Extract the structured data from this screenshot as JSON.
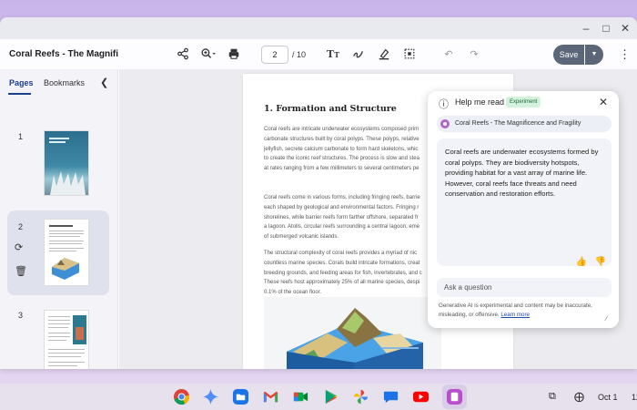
{
  "app": {
    "document_title": "Coral Reefs - The Magnific...",
    "page_current": "2",
    "page_total": "/ 10",
    "save_label": "Save"
  },
  "sidebar": {
    "tabs": [
      "Pages",
      "Bookmarks"
    ],
    "thumbnails": [
      {
        "number": "1"
      },
      {
        "number": "2"
      },
      {
        "number": "3"
      }
    ]
  },
  "document": {
    "heading": "1. Formation and Structure",
    "paragraphs": [
      [
        "Coral reefs are intricate underwater ecosystems composed prim",
        "carbonate structures built by coral polyps. These polyps, relative",
        "jellyfish, secrete calcium carbonate to form hard skeletons, whic",
        "to create the iconic reef structures. The process is slow and stea",
        "at rates ranging from a few millimeters to several centimeters pe"
      ],
      [
        "Coral reefs come in various forms, including fringing reefs, barrie",
        "each shaped by geological and environmental factors. Fringing r",
        "shorelines, while barrier reefs form farther offshore, separated fr",
        "a lagoon. Atolls, circular reefs surrounding a central lagoon, eme",
        "of submerged volcanic islands."
      ],
      [
        "The structural complexity of coral reefs provides a myriad of nic",
        "countless marine species. Corals build intricate formations, creat",
        "breeding grounds, and feeding areas for fish, invertebrates, and c",
        "These reefs host approximately 25% of all marine species, despi",
        "0.1% of the ocean floor."
      ]
    ]
  },
  "assistant": {
    "title": "Help me read",
    "badge": "Experiment",
    "source_chip": "Coral Reefs - The Magnificence and Fragility",
    "answer_lines": [
      "Coral reefs are underwater ecosystems formed by",
      "coral polyps. They are biodiversity hotspots,",
      "providing habitat for a vast array of marine life.",
      "However, coral reefs face threats and need",
      "conservation and restoration efforts."
    ],
    "input_placeholder": "Ask a question",
    "disclaimer_line1": "Generative AI is experimental and content may be inaccurate,",
    "disclaimer_line2": "misleading, or offensive.",
    "learn_more": "Learn more"
  },
  "shelf": {
    "apps": [
      "chrome",
      "gemini",
      "files",
      "gmail",
      "meet",
      "play-store",
      "photos",
      "messages",
      "youtube",
      "pdf-app"
    ],
    "date": "Oct 1",
    "time": "12"
  }
}
